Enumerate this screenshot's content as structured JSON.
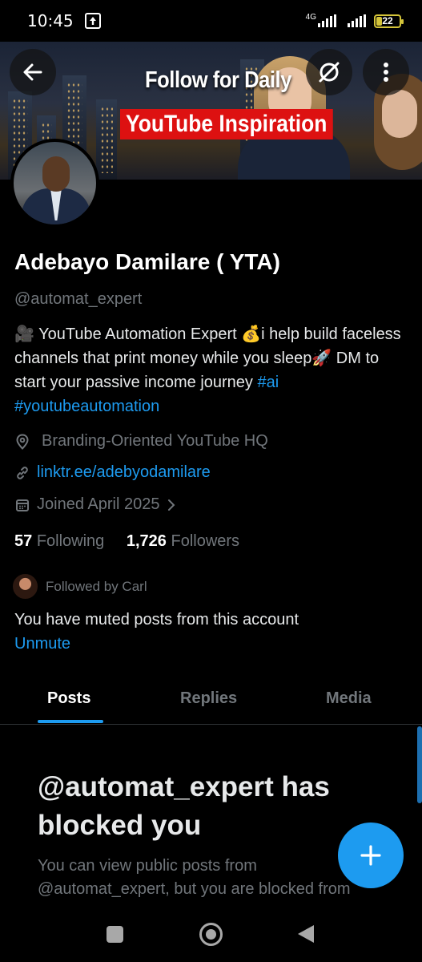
{
  "status_bar": {
    "time": "10:45",
    "network_label": "4G",
    "battery_level": "22"
  },
  "banner": {
    "title": "Follow for Daily",
    "subtitle": "YouTube Inspiration"
  },
  "profile": {
    "name": "Adebayo Damilare ( YTA)",
    "handle": "@automat_expert",
    "bio_text": "🎥 YouTube Automation Expert 💰i help build faceless channels that print money while you sleep🚀 DM to start your passive income journey ",
    "bio_hashtags": [
      "#ai",
      "#youtubeautomation"
    ],
    "location": "Branding-Oriented YouTube HQ",
    "website": "linktr.ee/adebyodamilare",
    "joined": "Joined April 2025",
    "following_count": "57",
    "following_label": "Following",
    "followers_count": "1,726",
    "followers_label": "Followers",
    "followed_by": "Followed by Carl",
    "muted_notice": "You have muted posts from this account",
    "unmute_label": "Unmute"
  },
  "tabs": [
    {
      "label": "Posts",
      "active": true
    },
    {
      "label": "Replies",
      "active": false
    },
    {
      "label": "Media",
      "active": false
    }
  ],
  "blocked": {
    "title": "@automat_expert has blocked you",
    "description": "You can view public posts from @automat_expert, but you are blocked from engaging with their posts."
  },
  "icons": {
    "back": "back-arrow-icon",
    "grok": "grok-icon",
    "more": "more-vertical-icon",
    "location": "location-pin-icon",
    "link": "link-icon",
    "calendar": "calendar-icon",
    "chevron": "chevron-right-icon",
    "compose": "plus-icon"
  },
  "colors": {
    "accent": "#1d9bf0",
    "background": "#000000",
    "secondary_text": "#71767b",
    "banner_badge": "#dd1111"
  }
}
